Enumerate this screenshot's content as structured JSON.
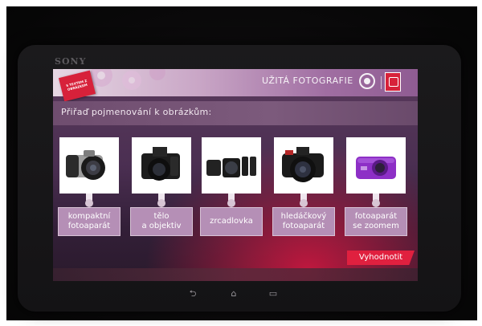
{
  "device": {
    "brand": "SONY"
  },
  "header": {
    "badge_text": "S TEXTEM\nZ OBRÁZKEM",
    "app_title": "UŽITÁ FOTOGRAFIE"
  },
  "instruction": "Přiřaď pojmenování k obrázkům:",
  "cards": [
    {
      "image": "bridge-camera"
    },
    {
      "image": "slr-body-and-lens"
    },
    {
      "image": "lenses"
    },
    {
      "image": "dslr-with-lens"
    },
    {
      "image": "purple-compact-zoom-camera"
    }
  ],
  "labels": [
    "kompaktní\nfotoaparát",
    "tělo\na objektiv",
    "zrcadlovka",
    "hledáčkový\nfotoaparát",
    "fotoaparát\nse zoomem"
  ],
  "evaluate_button": "Vyhodnotit",
  "nav": {
    "back": "⮌",
    "home": "⌂",
    "recent": "▭"
  },
  "colors": {
    "accent": "#e0203f",
    "label_bg": "#b58fb6",
    "screen_bg": "#4b2f52"
  }
}
